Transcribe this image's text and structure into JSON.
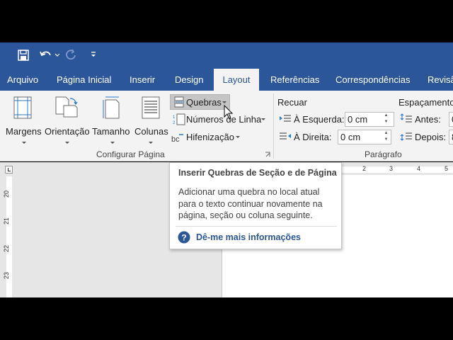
{
  "qat": {
    "save_icon": "save-icon",
    "undo_icon": "undo-icon",
    "redo_icon": "redo-icon",
    "customize_icon": "customize-arrow-icon"
  },
  "tabs": [
    {
      "label": "Arquivo"
    },
    {
      "label": "Página Inicial"
    },
    {
      "label": "Inserir"
    },
    {
      "label": "Design"
    },
    {
      "label": "Layout",
      "active": true
    },
    {
      "label": "Referências"
    },
    {
      "label": "Correspondências"
    },
    {
      "label": "Revisã"
    }
  ],
  "page_setup": {
    "margins": "Margens",
    "orientation": "Orientação",
    "size": "Tamanho",
    "columns": "Colunas",
    "breaks": "Quebras",
    "line_numbers": "Números de Linha",
    "hyphenation": "Hifenização",
    "group_label": "Configurar Página"
  },
  "indent": {
    "title": "Recuar",
    "left_label": "À Esquerda:",
    "left_value": "0 cm",
    "right_label": "À Direita:",
    "right_value": "0 cm"
  },
  "spacing": {
    "title": "Espaçamento",
    "before_label": "Antes:",
    "before_value": "0",
    "after_label": "Depois:",
    "after_value": "8"
  },
  "paragraph_group_label": "Parágrafo",
  "tooltip": {
    "title": "Inserir Quebras de Seção e de Página",
    "body": "Adicionar uma quebra no local atual para o texto continuar novamente na página, seção ou coluna seguinte.",
    "link": "Dê-me mais informações"
  },
  "ruler": {
    "h_marks": [
      "2",
      "3",
      "4",
      "5"
    ],
    "v_marks": [
      "20",
      "21",
      "22",
      "23"
    ]
  },
  "colors": {
    "accent": "#2b579a",
    "ribbon": "#f3f3f3",
    "canvas": "#e6e6e6"
  }
}
